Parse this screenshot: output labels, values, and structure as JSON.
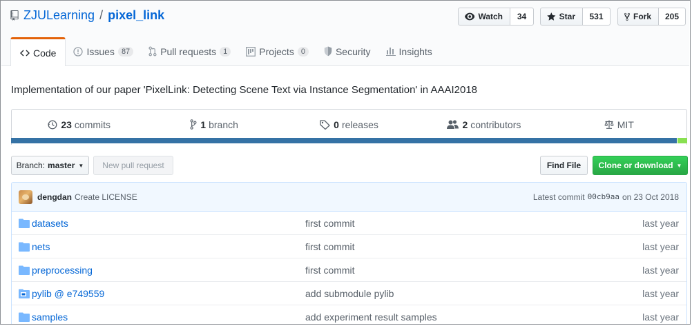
{
  "repo": {
    "owner": "ZJULearning",
    "separator": "/",
    "name": "pixel_link"
  },
  "social": {
    "watch": {
      "label": "Watch",
      "count": "34"
    },
    "star": {
      "label": "Star",
      "count": "531"
    },
    "fork": {
      "label": "Fork",
      "count": "205"
    }
  },
  "tabs": [
    {
      "label": "Code",
      "counter": "",
      "icon": "code-icon"
    },
    {
      "label": "Issues",
      "counter": "87",
      "icon": "issue-icon"
    },
    {
      "label": "Pull requests",
      "counter": "1",
      "icon": "pull-request-icon"
    },
    {
      "label": "Projects",
      "counter": "0",
      "icon": "project-icon"
    },
    {
      "label": "Security",
      "counter": "",
      "icon": "shield-icon"
    },
    {
      "label": "Insights",
      "counter": "",
      "icon": "graph-icon"
    }
  ],
  "description": "Implementation of our paper 'PixelLink: Detecting Scene Text via Instance Segmentation' in AAAI2018",
  "summary": {
    "commits": {
      "num": "23",
      "label": "commits"
    },
    "branches": {
      "num": "1",
      "label": "branch"
    },
    "releases": {
      "num": "0",
      "label": "releases"
    },
    "contributors": {
      "num": "2",
      "label": "contributors"
    },
    "license": {
      "label": "MIT"
    }
  },
  "language_colors": {
    "primary": "#3572a5",
    "secondary": "#89e051"
  },
  "toolbar": {
    "branch_prefix": "Branch:",
    "branch_name": "master",
    "new_pull_request": "New pull request",
    "find_file": "Find File",
    "clone_download": "Clone or download"
  },
  "latest_commit": {
    "author": "dengdan",
    "message": "Create LICENSE",
    "prefix": "Latest commit",
    "sha": "00cb9aa",
    "date": "on 23 Oct 2018"
  },
  "files": [
    {
      "name": "datasets",
      "message": "first commit",
      "age": "last year",
      "icon": "folder-icon"
    },
    {
      "name": "nets",
      "message": "first commit",
      "age": "last year",
      "icon": "folder-icon"
    },
    {
      "name": "preprocessing",
      "message": "first commit",
      "age": "last year",
      "icon": "folder-icon"
    },
    {
      "name": "pylib @ e749559",
      "message": "add submodule pylib",
      "age": "last year",
      "icon": "submodule-icon"
    },
    {
      "name": "samples",
      "message": "add experiment result samples",
      "age": "last year",
      "icon": "folder-icon"
    }
  ]
}
